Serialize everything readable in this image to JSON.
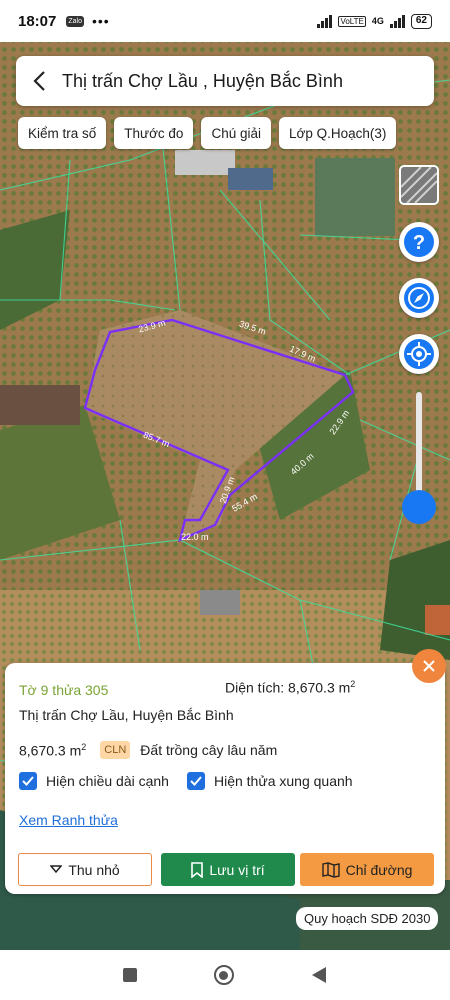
{
  "status": {
    "time": "18:07",
    "app_badge": "Zalo",
    "dots": "•••",
    "net_tag": "VoLTE",
    "net_gen": "4G",
    "battery": "62"
  },
  "header": {
    "title": "Thị trấn Chợ Lầu , Huyện Bắc Bình"
  },
  "chips": [
    {
      "label": "Kiểm tra số"
    },
    {
      "label": "Thước đo"
    },
    {
      "label": "Chú giải"
    },
    {
      "label": "Lớp Q.Hoạch(3)"
    }
  ],
  "map": {
    "edge_labels": [
      "23.9 m",
      "39.5 m",
      "17.9 m",
      "22.9 m",
      "40.0 m",
      "55.4 m",
      "22.0 m",
      "20.9 m",
      "85.7 m"
    ],
    "boundary_color": "#7b2ff7"
  },
  "panel": {
    "sheet_parcel": "Tờ 9 thửa 305",
    "area_label": "Diện tích: 8,670.3 m",
    "area_exp": "2",
    "address": "Thị trấn Chợ Lầu, Huyện Bắc Bình",
    "area_value": "8,670.3 m",
    "area_value_exp": "2",
    "land_code": "CLN",
    "land_type": "Đất trồng cây lâu năm",
    "check_edge_length": "Hiện chiều dài cạnh",
    "check_neighbors": "Hiện thửa xung quanh",
    "view_boundary_link": "Xem Ranh thửa",
    "btn_minimize": "Thu nhỏ",
    "btn_save": "Lưu vị trí",
    "btn_route": "Chỉ đường"
  },
  "plan_label": "Quy hoạch SDĐ 2030",
  "colors": {
    "accent_blue": "#1877f2",
    "orange": "#f0863e",
    "green_btn": "#1f8a4c",
    "parcel_text": "#7aa534"
  }
}
